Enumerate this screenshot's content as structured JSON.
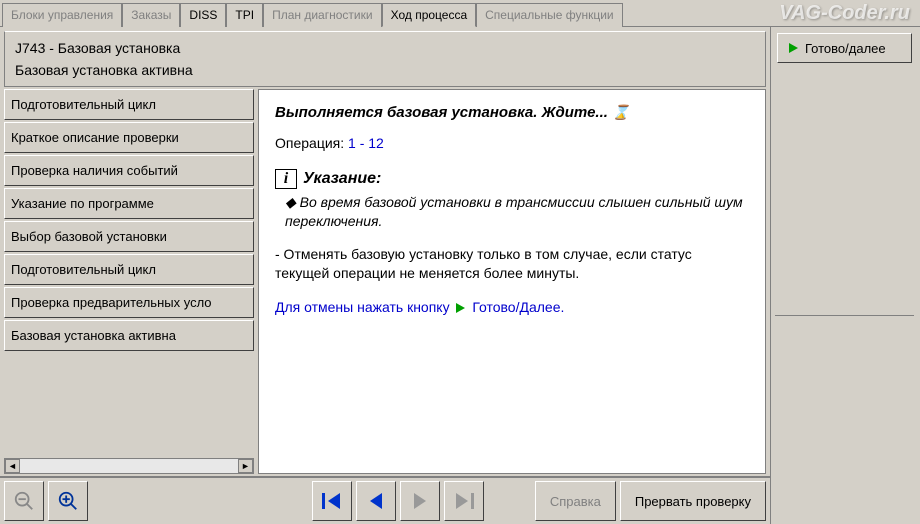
{
  "tabs": {
    "control_units": "Блоки управления",
    "orders": "Заказы",
    "diss": "DISS",
    "tpi": "TPI",
    "diag_plan": "План диагностики",
    "process_flow": "Ход процесса",
    "special_functions": "Специальные функции"
  },
  "watermark": "VAG-Coder.ru",
  "header": {
    "title": "J743 - Базовая установка",
    "subtitle": "Базовая установка активна"
  },
  "sidebar": {
    "items": [
      "Подготовительный цикл",
      "Краткое описание проверки",
      "Проверка наличия событий",
      "Указание по программе",
      "Выбор базовой установки",
      "Подготовительный цикл",
      "Проверка предварительных усло",
      "Базовая установка активна"
    ]
  },
  "content": {
    "headline": "Выполняется базовая установка. Ждите...",
    "operation_label": "Операция:",
    "operation_value": "1 - 12",
    "note_title": "Указание:",
    "note_body": "Во время базовой установки в трансмиссии слышен сильный шум переключения.",
    "instruction": "- Отменять базовую установку только в том случае, если статус текущей операции не меняется более минуты.",
    "cancel_prefix": "Для отмены нажать кнопку",
    "cancel_button": "Готово/Далее."
  },
  "right": {
    "ready_label": "Готово/далее"
  },
  "footer": {
    "help": "Справка",
    "abort": "Прервать проверку"
  }
}
